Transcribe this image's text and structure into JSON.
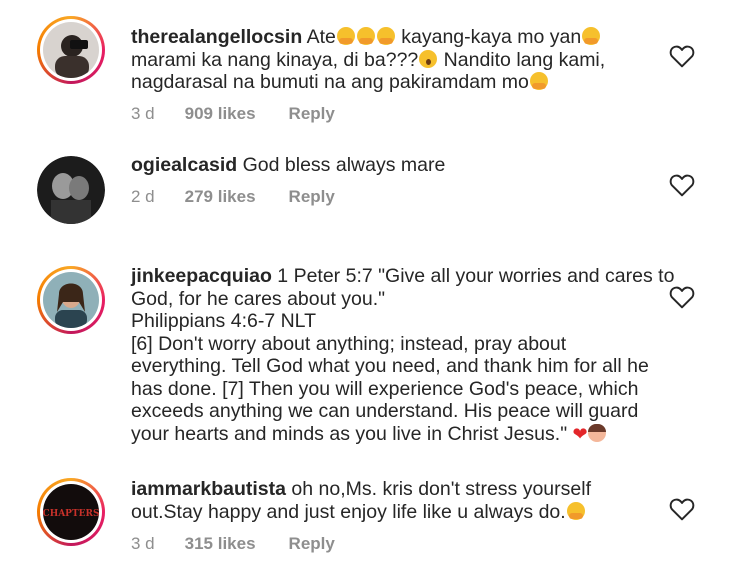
{
  "comments": [
    {
      "username": "therealangellocsin",
      "lines": [
        {
          "pre": " Ate",
          "mid": " kayang-kaya mo yan",
          "post": ""
        },
        {
          "pre": "marami ka nang kinaya, di ba???",
          "mid": " Nandito lang kami,",
          "post": ""
        },
        {
          "pre": "nagdarasal na bumuti na ang pakiramdam mo",
          "mid": "",
          "post": ""
        }
      ],
      "time": "3 d",
      "likes": "909 likes",
      "reply": "Reply"
    },
    {
      "username": "ogiealcasid",
      "lines": [
        {
          "pre": " God bless always mare"
        }
      ],
      "time": "2 d",
      "likes": "279 likes",
      "reply": "Reply"
    },
    {
      "username": "jinkeepacquiao",
      "lines": [
        {
          "pre": " 1 Peter 5:7 \"Give all your worries and cares to"
        },
        {
          "pre": "God, for he cares about you.\""
        },
        {
          "pre": "Philippians 4:6-7 NLT"
        },
        {
          "pre": "[6] Don't worry about anything; instead, pray about"
        },
        {
          "pre": "everything. Tell God what you need, and thank him for all he"
        },
        {
          "pre": "has done. [7] Then you will experience God's peace, which"
        },
        {
          "pre": "exceeds anything we can understand. His peace will guard"
        },
        {
          "pre": "your hearts and minds as you live in Christ Jesus.\""
        }
      ]
    },
    {
      "username": "iammarkbautista",
      "lines": [
        {
          "pre": " oh no,Ms. kris don't stress yourself"
        },
        {
          "pre": "out.Stay happy and just enjoy life like u always do."
        }
      ],
      "avatar_text": "CHAPTERS",
      "time": "3 d",
      "likes": "315 likes",
      "reply": "Reply"
    }
  ],
  "icons": {
    "like": "heart-outline-icon"
  },
  "colors": {
    "text": "#262626",
    "meta": "#8e8e8e",
    "ring_start": "#f9a825",
    "ring_end": "#e91e63"
  }
}
